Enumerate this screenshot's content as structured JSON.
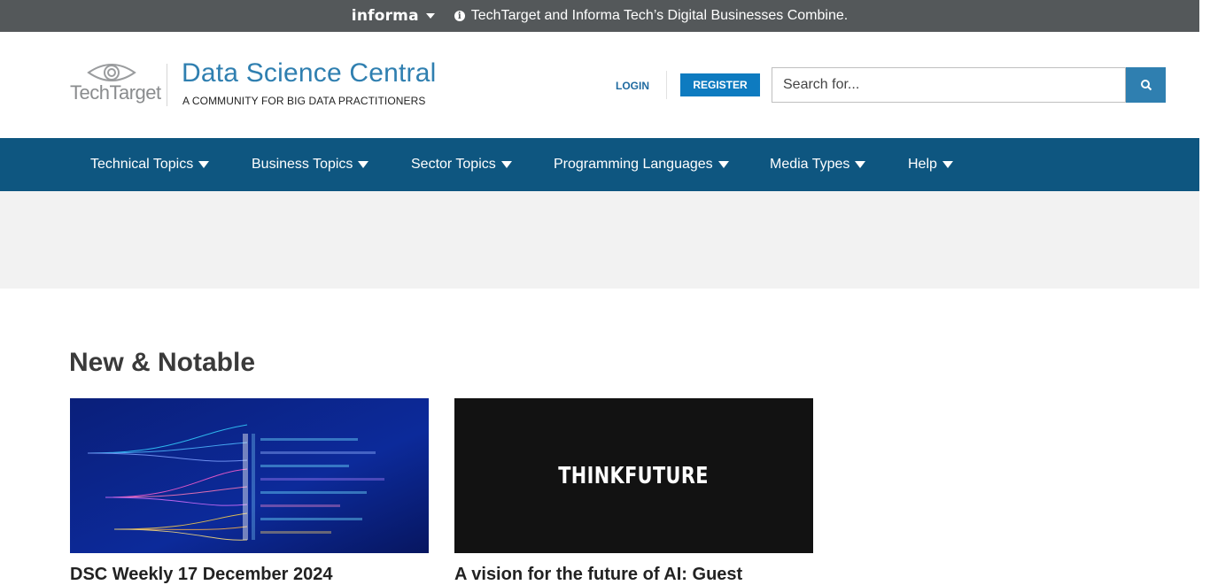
{
  "topbar": {
    "brand": "informa",
    "notice": "TechTarget and Informa Tech’s Digital Businesses Combine."
  },
  "header": {
    "tt_logo_text": "TechTarget",
    "site_title": "Data Science Central",
    "tagline": "A COMMUNITY FOR BIG DATA PRACTITIONERS",
    "login_label": "LOGIN",
    "register_label": "REGISTER",
    "search_placeholder": "Search for...",
    "search_value": ""
  },
  "nav": {
    "items": [
      {
        "label": "Technical Topics"
      },
      {
        "label": "Business Topics"
      },
      {
        "label": "Sector Topics"
      },
      {
        "label": "Programming Languages"
      },
      {
        "label": "Media Types"
      },
      {
        "label": "Help"
      }
    ]
  },
  "main": {
    "section_title": "New & Notable",
    "cards": [
      {
        "title": "DSC Weekly 17 December 2024"
      },
      {
        "title": "A vision for the future of AI: Guest",
        "image_text": "THINKFUTURE"
      }
    ]
  },
  "colors": {
    "topbar": "#54585a",
    "nav": "#0e5680",
    "accent": "#2f7fb0",
    "register": "#0e7bc0"
  }
}
